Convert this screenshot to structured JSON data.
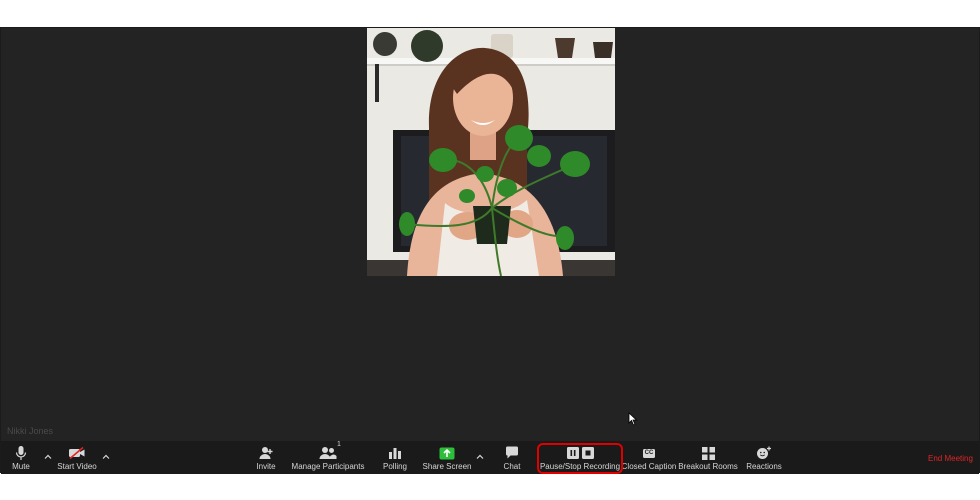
{
  "participant": {
    "name_tag": "Nikki Jones"
  },
  "toolbar": {
    "mute_label": "Mute",
    "start_video_label": "Start Video",
    "invite_label": "Invite",
    "manage_participants_label": "Manage Participants",
    "participant_count": "1",
    "polling_label": "Polling",
    "share_screen_label": "Share Screen",
    "chat_label": "Chat",
    "recording_label": "Pause/Stop Recording",
    "closed_caption_label": "Closed Caption",
    "closed_caption_icon_text": "CC",
    "breakout_rooms_label": "Breakout Rooms",
    "reactions_label": "Reactions",
    "end_meeting_label": "End Meeting"
  },
  "colors": {
    "background": "#232323",
    "toolbar": "#1a1a1a",
    "share_screen_green": "#2dbe3b",
    "end_meeting_red": "#e02525",
    "highlight_red": "#e00000"
  },
  "icons": [
    "microphone-icon",
    "video-off-icon",
    "add-user-icon",
    "participants-icon",
    "bar-chart-icon",
    "share-screen-arrow-icon",
    "chat-bubble-icon",
    "pause-icon",
    "stop-icon",
    "cc-icon",
    "grid-icon",
    "smiley-add-icon",
    "caret-up-icon",
    "mouse-cursor-icon"
  ]
}
